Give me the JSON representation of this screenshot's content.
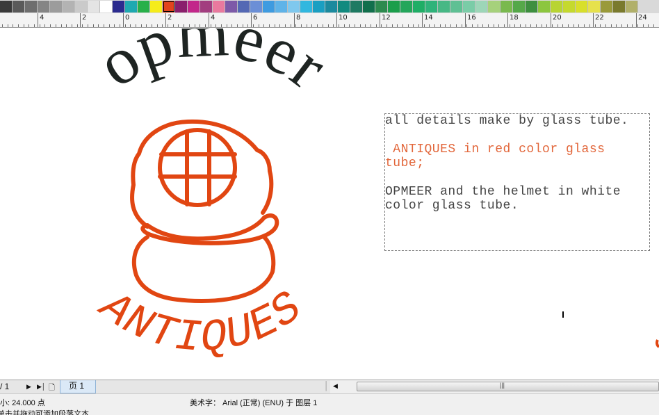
{
  "palette": {
    "colors": [
      "#3a3a3a",
      "#5a5a5a",
      "#6e6e6e",
      "#858585",
      "#9c9c9c",
      "#b3b3b3",
      "#cacaca",
      "#e4e4e4",
      "#ffffff",
      "#2b2b8f",
      "#1fa9b0",
      "#28b04a",
      "#f5ec1b",
      "#e2441d",
      "#8a1f6c",
      "#c2278a",
      "#a23d7f",
      "#e9799e",
      "#7d5aa8",
      "#5468b4",
      "#6b8fd6",
      "#3e9be0",
      "#5fb3e8",
      "#7fc8ee",
      "#31b7df",
      "#1a9fc2",
      "#1c8a9e",
      "#128a7f",
      "#1f7a62",
      "#126f4c",
      "#2d8a4e",
      "#1b9e4b",
      "#24a65b",
      "#1fae66",
      "#2fb37a",
      "#47b885",
      "#5fc094",
      "#7acca7",
      "#9dd6b8",
      "#a6d17b",
      "#79b94e",
      "#55a849",
      "#3d8f3f",
      "#8cc63f",
      "#b8d433",
      "#c5d92e",
      "#d8df2b",
      "#e6e14c",
      "#9a9a3a",
      "#7a7a2d",
      "#b1b06a"
    ],
    "selected_index": 13
  },
  "ruler": {
    "labels": [
      "4",
      "2",
      "0",
      "2",
      "4",
      "6",
      "8",
      "10",
      "12",
      "14",
      "16",
      "18",
      "20",
      "22",
      "24"
    ]
  },
  "artwork": {
    "arc_top_text": "opmeer",
    "arc_bottom_text": "ANTIQUES",
    "dark_color": "#1e2422",
    "accent_color": "#e14612"
  },
  "text_frame": {
    "line1": "all details make by glass tube.",
    "line2": " ANTIQUES in red color glass",
    "line3": "tube;",
    "line4": "OPMEER and the helmet in white",
    "line5": "color glass tube.",
    "grey_color": "#444444",
    "red_color": "#e2663a"
  },
  "pagebar": {
    "page_counter": "/ 1",
    "tab_label": "页 1"
  },
  "status": {
    "size_text": "小: 24.000 点",
    "font_text": "美术字： Arial (正常) (ENU) 于 图层 1",
    "hint_text": "单击并拖动可添加段落文本"
  }
}
